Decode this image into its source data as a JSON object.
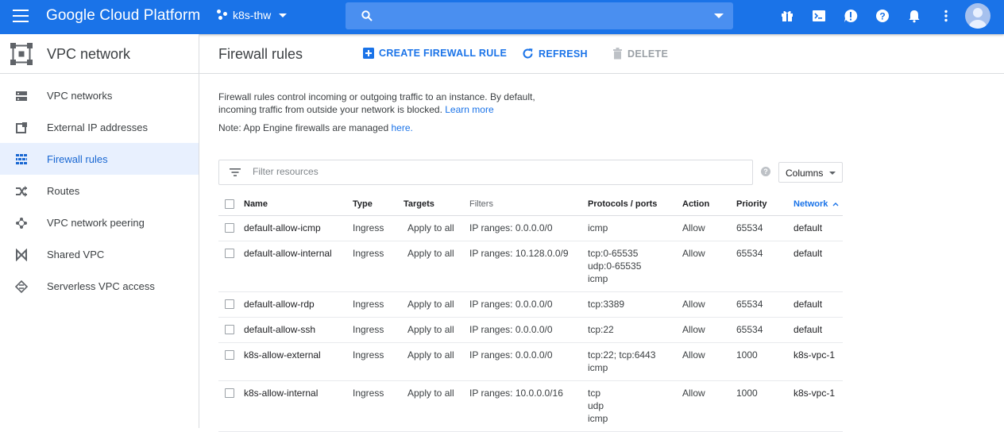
{
  "topbar": {
    "brand": "Google Cloud Platform",
    "project": "k8s-thw",
    "search_placeholder": ""
  },
  "sidebar": {
    "title": "VPC network",
    "items": [
      {
        "label": "VPC networks",
        "icon": "vpc-networks-icon"
      },
      {
        "label": "External IP addresses",
        "icon": "external-ip-icon"
      },
      {
        "label": "Firewall rules",
        "icon": "firewall-icon",
        "active": true
      },
      {
        "label": "Routes",
        "icon": "routes-icon"
      },
      {
        "label": "VPC network peering",
        "icon": "peering-icon"
      },
      {
        "label": "Shared VPC",
        "icon": "shared-vpc-icon"
      },
      {
        "label": "Serverless VPC access",
        "icon": "serverless-icon"
      }
    ]
  },
  "main": {
    "title": "Firewall rules",
    "create_label": "CREATE FIREWALL RULE",
    "refresh_label": "REFRESH",
    "delete_label": "DELETE",
    "desc_line1": "Firewall rules control incoming or outgoing traffic to an instance. By default,",
    "desc_line2": "incoming traffic from outside your network is blocked.",
    "learn_more": "Learn more",
    "note_text": "Note: App Engine firewalls are managed",
    "note_link": "here.",
    "filter_placeholder": "Filter resources",
    "columns_label": "Columns"
  },
  "table": {
    "headers": {
      "name": "Name",
      "type": "Type",
      "targets": "Targets",
      "filters": "Filters",
      "protocols": "Protocols / ports",
      "action": "Action",
      "priority": "Priority",
      "network": "Network"
    },
    "rows": [
      {
        "name": "default-allow-icmp",
        "type": "Ingress",
        "targets": "Apply to all",
        "filters": "IP ranges: 0.0.0.0/0",
        "protocols": [
          "icmp"
        ],
        "action": "Allow",
        "priority": "65534",
        "network": "default"
      },
      {
        "name": "default-allow-internal",
        "type": "Ingress",
        "targets": "Apply to all",
        "filters": "IP ranges: 10.128.0.0/9",
        "protocols": [
          "tcp:0-65535",
          "udp:0-65535",
          "icmp"
        ],
        "action": "Allow",
        "priority": "65534",
        "network": "default"
      },
      {
        "name": "default-allow-rdp",
        "type": "Ingress",
        "targets": "Apply to all",
        "filters": "IP ranges: 0.0.0.0/0",
        "protocols": [
          "tcp:3389"
        ],
        "action": "Allow",
        "priority": "65534",
        "network": "default"
      },
      {
        "name": "default-allow-ssh",
        "type": "Ingress",
        "targets": "Apply to all",
        "filters": "IP ranges: 0.0.0.0/0",
        "protocols": [
          "tcp:22"
        ],
        "action": "Allow",
        "priority": "65534",
        "network": "default"
      },
      {
        "name": "k8s-allow-external",
        "type": "Ingress",
        "targets": "Apply to all",
        "filters": "IP ranges: 0.0.0.0/0",
        "protocols": [
          "tcp:22; tcp:6443",
          "icmp"
        ],
        "action": "Allow",
        "priority": "1000",
        "network": "k8s-vpc-1"
      },
      {
        "name": "k8s-allow-internal",
        "type": "Ingress",
        "targets": "Apply to all",
        "filters": "IP ranges: 10.0.0.0/16",
        "protocols": [
          "tcp",
          "udp",
          "icmp"
        ],
        "action": "Allow",
        "priority": "1000",
        "network": "k8s-vpc-1"
      }
    ]
  },
  "colors": {
    "primary": "#1a73e8",
    "active_bg": "#e8f0fe",
    "disabled": "#9aa0a6"
  }
}
